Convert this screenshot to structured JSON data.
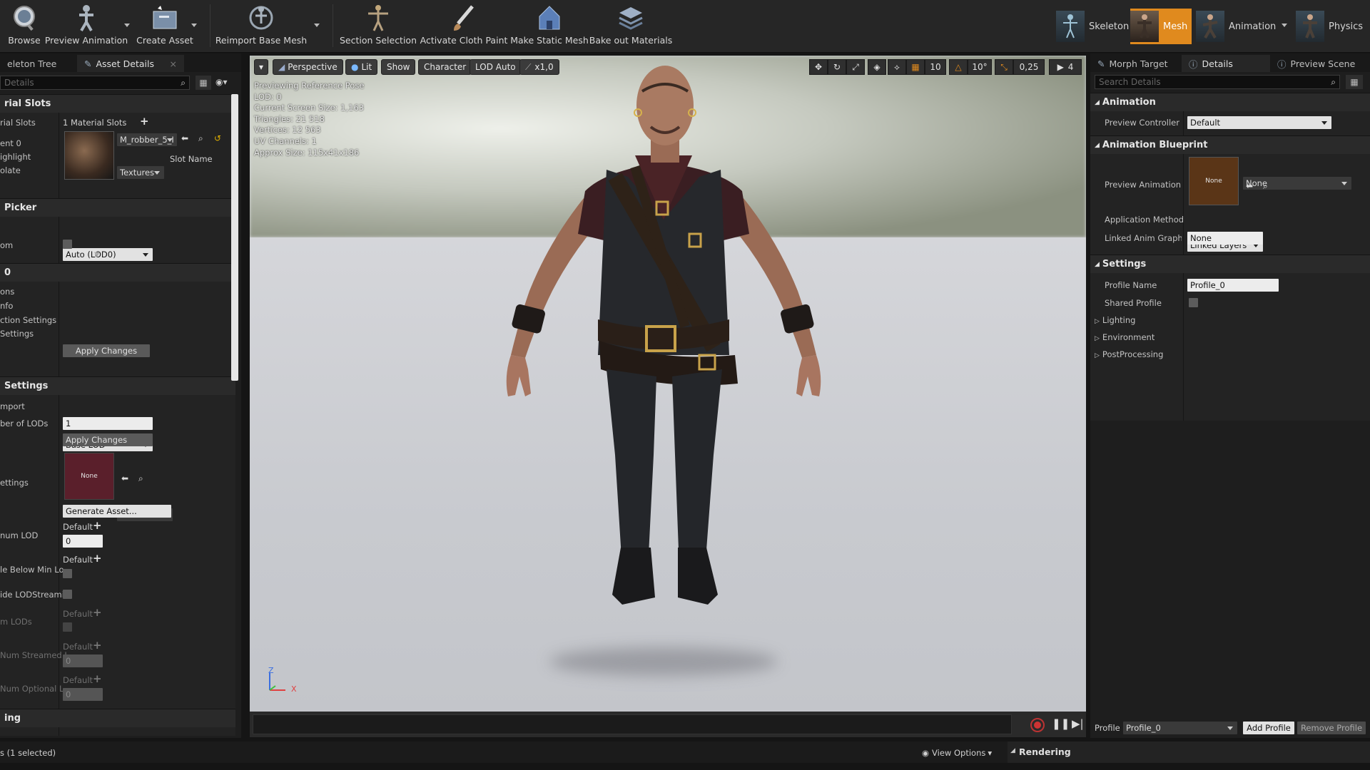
{
  "toolbar": {
    "buttons": [
      {
        "label": "Browse",
        "icon": "browse-icon"
      },
      {
        "label": "Preview Animation",
        "icon": "preview-animation-icon"
      },
      {
        "label": "Create Asset",
        "icon": "create-asset-icon"
      },
      {
        "label": "Reimport Base Mesh",
        "icon": "reimport-icon"
      },
      {
        "label": "Section Selection",
        "icon": "section-selection-icon"
      },
      {
        "label": "Activate Cloth Paint",
        "icon": "cloth-paint-icon"
      },
      {
        "label": "Make Static Mesh",
        "icon": "static-mesh-icon"
      },
      {
        "label": "Bake out Materials",
        "icon": "bake-materials-icon"
      }
    ],
    "modes": [
      {
        "label": "Skeleton",
        "active": false
      },
      {
        "label": "Mesh",
        "active": true
      },
      {
        "label": "Animation",
        "active": false
      },
      {
        "label": "Physics",
        "active": false
      }
    ],
    "accent": "#e08a1e"
  },
  "left_panel": {
    "tabs": [
      "eleton Tree",
      "Asset Details"
    ],
    "search_placeholder": "Details",
    "material_slots": {
      "title": "rial Slots",
      "label": "rial Slots",
      "count": "1 Material Slots",
      "element_label": "ent 0",
      "highlight_label": "ighlight",
      "isolate_label": "olate",
      "material_name": "M_robber_5_I",
      "textures_label": "Textures",
      "slot_name_label": "Slot Name"
    },
    "lod_picker": {
      "title": "Picker",
      "combo": "Auto (LOD0)",
      "custom_label": "om"
    },
    "lod0": {
      "title": "0",
      "rows": [
        "ons",
        "nfo",
        "ction Settings",
        "Settings"
      ],
      "apply": "Apply Changes"
    },
    "lod_settings": {
      "title": "Settings",
      "import_label": "mport",
      "import_value": "Base LOD",
      "num_lods_label": "ber of LODs",
      "num_lods_value": "1",
      "apply": "Apply Changes",
      "settings_label": "ettings",
      "thumb_none": "None",
      "none_combo": "None",
      "generate": "Generate Asset...",
      "min_lod_label": "num LOD",
      "default_1": "Default",
      "min_lod_value": "0",
      "default_2": "Default",
      "disable_below_label": "le Below Min Lo",
      "override_label": "ide LODStreami",
      "stream_lods_label": "m LODs",
      "default_3": "Default",
      "num_streamed_label": "Num Streamed L",
      "default_4": "Default",
      "num_streamed_value": "0",
      "num_optional_label": "Num Optional L",
      "default_5": "Default",
      "num_optional_value": "0"
    },
    "bottom_cat": "ing"
  },
  "viewport": {
    "menu_label": "",
    "perspective": "Perspective",
    "lit": "Lit",
    "show": "Show",
    "character": "Character",
    "lod": "LOD Auto",
    "speed": "x1,0",
    "grid_snap": "10",
    "rot_snap": "10°",
    "scale_snap": "0,25",
    "cam_speed": "4",
    "stats": [
      "Previewing Reference Pose",
      "LOD: 0",
      "Current Screen Size: 1,163",
      "Triangles: 21 518",
      "Vertices: 12 563",
      "UV Channels: 1",
      "Approx Size: 115x41x186"
    ],
    "axis_z": "Z",
    "axis_x": "X"
  },
  "right_panel": {
    "tabs": [
      "Morph Target",
      "Details",
      "Preview Scene"
    ],
    "search_placeholder": "Search Details",
    "animation": {
      "title": "Animation",
      "preview_controller_label": "Preview Controller",
      "preview_controller_value": "Default"
    },
    "anim_blueprint": {
      "title": "Animation Blueprint",
      "preview_label": "Preview Animation Bl",
      "thumb_none": "None",
      "combo": "None",
      "app_method_label": "Application Method",
      "app_method_value": "Linked Layers",
      "linked_label": "Linked Anim Graph Ta",
      "linked_value": "None"
    },
    "settings": {
      "title": "Settings",
      "profile_name_label": "Profile Name",
      "profile_name_value": "Profile_0",
      "shared_label": "Shared Profile",
      "lighting": "Lighting",
      "environment": "Environment",
      "postprocessing": "PostProcessing"
    },
    "profile_label": "Profile",
    "profile_value": "Profile_0",
    "add_profile": "Add Profile",
    "remove_profile": "Remove Profile"
  },
  "status": {
    "selection": "s (1 selected)",
    "view_options": "View Options",
    "rendering": "Rendering"
  }
}
